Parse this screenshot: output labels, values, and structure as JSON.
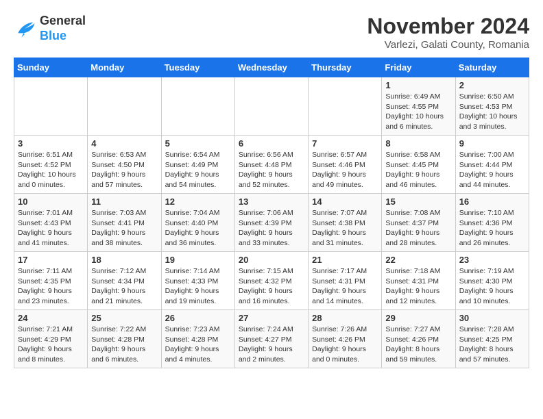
{
  "logo": {
    "line1": "General",
    "line2": "Blue"
  },
  "title": "November 2024",
  "location": "Varlezi, Galati County, Romania",
  "weekdays": [
    "Sunday",
    "Monday",
    "Tuesday",
    "Wednesday",
    "Thursday",
    "Friday",
    "Saturday"
  ],
  "weeks": [
    [
      {
        "day": "",
        "info": ""
      },
      {
        "day": "",
        "info": ""
      },
      {
        "day": "",
        "info": ""
      },
      {
        "day": "",
        "info": ""
      },
      {
        "day": "",
        "info": ""
      },
      {
        "day": "1",
        "info": "Sunrise: 6:49 AM\nSunset: 4:55 PM\nDaylight: 10 hours\nand 6 minutes."
      },
      {
        "day": "2",
        "info": "Sunrise: 6:50 AM\nSunset: 4:53 PM\nDaylight: 10 hours\nand 3 minutes."
      }
    ],
    [
      {
        "day": "3",
        "info": "Sunrise: 6:51 AM\nSunset: 4:52 PM\nDaylight: 10 hours\nand 0 minutes."
      },
      {
        "day": "4",
        "info": "Sunrise: 6:53 AM\nSunset: 4:50 PM\nDaylight: 9 hours\nand 57 minutes."
      },
      {
        "day": "5",
        "info": "Sunrise: 6:54 AM\nSunset: 4:49 PM\nDaylight: 9 hours\nand 54 minutes."
      },
      {
        "day": "6",
        "info": "Sunrise: 6:56 AM\nSunset: 4:48 PM\nDaylight: 9 hours\nand 52 minutes."
      },
      {
        "day": "7",
        "info": "Sunrise: 6:57 AM\nSunset: 4:46 PM\nDaylight: 9 hours\nand 49 minutes."
      },
      {
        "day": "8",
        "info": "Sunrise: 6:58 AM\nSunset: 4:45 PM\nDaylight: 9 hours\nand 46 minutes."
      },
      {
        "day": "9",
        "info": "Sunrise: 7:00 AM\nSunset: 4:44 PM\nDaylight: 9 hours\nand 44 minutes."
      }
    ],
    [
      {
        "day": "10",
        "info": "Sunrise: 7:01 AM\nSunset: 4:43 PM\nDaylight: 9 hours\nand 41 minutes."
      },
      {
        "day": "11",
        "info": "Sunrise: 7:03 AM\nSunset: 4:41 PM\nDaylight: 9 hours\nand 38 minutes."
      },
      {
        "day": "12",
        "info": "Sunrise: 7:04 AM\nSunset: 4:40 PM\nDaylight: 9 hours\nand 36 minutes."
      },
      {
        "day": "13",
        "info": "Sunrise: 7:06 AM\nSunset: 4:39 PM\nDaylight: 9 hours\nand 33 minutes."
      },
      {
        "day": "14",
        "info": "Sunrise: 7:07 AM\nSunset: 4:38 PM\nDaylight: 9 hours\nand 31 minutes."
      },
      {
        "day": "15",
        "info": "Sunrise: 7:08 AM\nSunset: 4:37 PM\nDaylight: 9 hours\nand 28 minutes."
      },
      {
        "day": "16",
        "info": "Sunrise: 7:10 AM\nSunset: 4:36 PM\nDaylight: 9 hours\nand 26 minutes."
      }
    ],
    [
      {
        "day": "17",
        "info": "Sunrise: 7:11 AM\nSunset: 4:35 PM\nDaylight: 9 hours\nand 23 minutes."
      },
      {
        "day": "18",
        "info": "Sunrise: 7:12 AM\nSunset: 4:34 PM\nDaylight: 9 hours\nand 21 minutes."
      },
      {
        "day": "19",
        "info": "Sunrise: 7:14 AM\nSunset: 4:33 PM\nDaylight: 9 hours\nand 19 minutes."
      },
      {
        "day": "20",
        "info": "Sunrise: 7:15 AM\nSunset: 4:32 PM\nDaylight: 9 hours\nand 16 minutes."
      },
      {
        "day": "21",
        "info": "Sunrise: 7:17 AM\nSunset: 4:31 PM\nDaylight: 9 hours\nand 14 minutes."
      },
      {
        "day": "22",
        "info": "Sunrise: 7:18 AM\nSunset: 4:31 PM\nDaylight: 9 hours\nand 12 minutes."
      },
      {
        "day": "23",
        "info": "Sunrise: 7:19 AM\nSunset: 4:30 PM\nDaylight: 9 hours\nand 10 minutes."
      }
    ],
    [
      {
        "day": "24",
        "info": "Sunrise: 7:21 AM\nSunset: 4:29 PM\nDaylight: 9 hours\nand 8 minutes."
      },
      {
        "day": "25",
        "info": "Sunrise: 7:22 AM\nSunset: 4:28 PM\nDaylight: 9 hours\nand 6 minutes."
      },
      {
        "day": "26",
        "info": "Sunrise: 7:23 AM\nSunset: 4:28 PM\nDaylight: 9 hours\nand 4 minutes."
      },
      {
        "day": "27",
        "info": "Sunrise: 7:24 AM\nSunset: 4:27 PM\nDaylight: 9 hours\nand 2 minutes."
      },
      {
        "day": "28",
        "info": "Sunrise: 7:26 AM\nSunset: 4:26 PM\nDaylight: 9 hours\nand 0 minutes."
      },
      {
        "day": "29",
        "info": "Sunrise: 7:27 AM\nSunset: 4:26 PM\nDaylight: 8 hours\nand 59 minutes."
      },
      {
        "day": "30",
        "info": "Sunrise: 7:28 AM\nSunset: 4:25 PM\nDaylight: 8 hours\nand 57 minutes."
      }
    ]
  ]
}
